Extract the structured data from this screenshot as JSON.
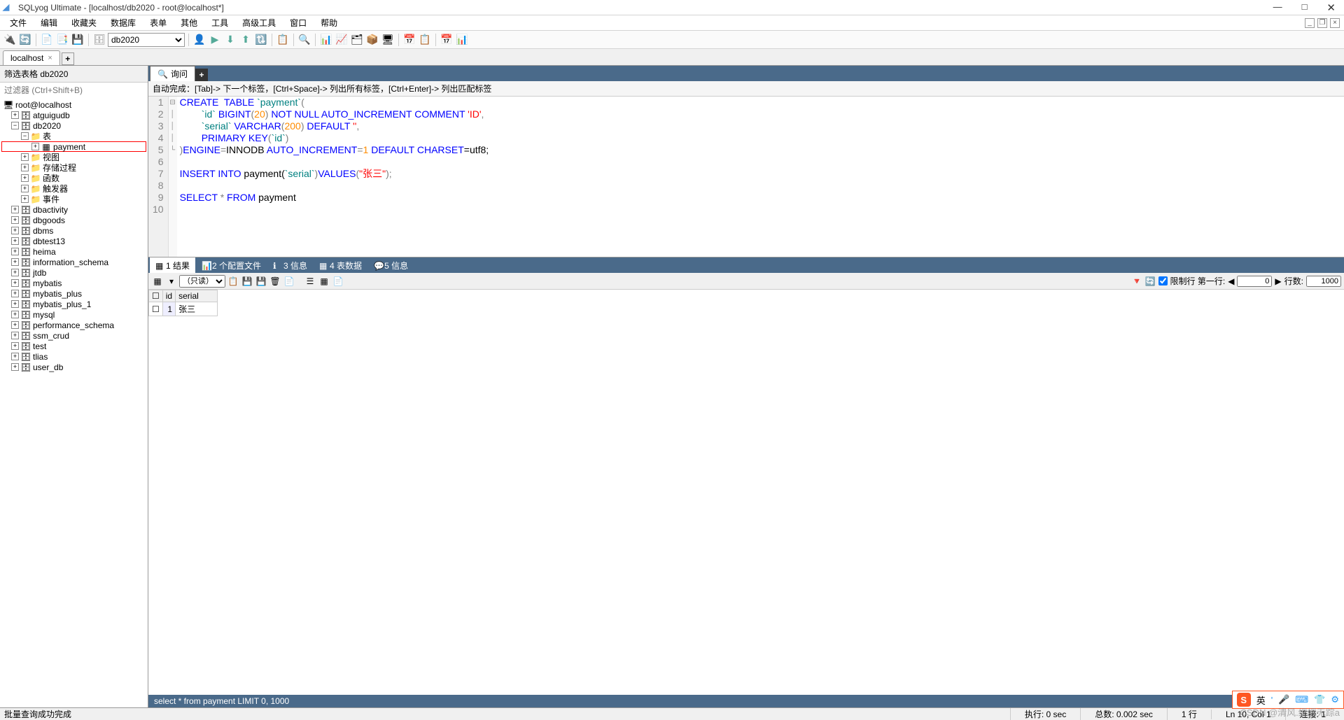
{
  "title": "SQLyog Ultimate - [localhost/db2020 - root@localhost*]",
  "menu": [
    "文件",
    "编辑",
    "收藏夹",
    "数据库",
    "表单",
    "其他",
    "工具",
    "高级工具",
    "窗口",
    "帮助"
  ],
  "db_dropdown": "db2020",
  "conn_tab": "localhost",
  "filter_label": "筛选表格 db2020",
  "filter_placeholder": "过滤器 (Ctrl+Shift+B)",
  "tree": {
    "root": "root@localhost",
    "databases": [
      "atguigudb",
      "db2020"
    ],
    "db2020_children": [
      {
        "label": "表",
        "exp": "−"
      },
      {
        "label": "payment",
        "highlighted": true,
        "indent": 3
      },
      {
        "label": "视图",
        "exp": "+"
      },
      {
        "label": "存储过程",
        "exp": "+"
      },
      {
        "label": "函数",
        "exp": "+"
      },
      {
        "label": "触发器",
        "exp": "+"
      },
      {
        "label": "事件",
        "exp": "+"
      }
    ],
    "rest": [
      "dbactivity",
      "dbgoods",
      "dbms",
      "dbtest13",
      "heima",
      "information_schema",
      "jtdb",
      "mybatis",
      "mybatis_plus",
      "mybatis_plus_1",
      "mysql",
      "performance_schema",
      "ssm_crud",
      "test",
      "tlias",
      "user_db"
    ]
  },
  "query_tab": "询问",
  "hint": "自动完成：[Tab]-> 下一个标签，[Ctrl+Space]-> 列出所有标签，[Ctrl+Enter]-> 列出匹配标签",
  "code_lines": [
    1,
    2,
    3,
    4,
    5,
    6,
    7,
    8,
    9,
    10
  ],
  "sql": {
    "l1": {
      "a": "CREATE",
      "b": "TABLE",
      "c": "`payment`",
      "d": "("
    },
    "l2": {
      "a": "`id`",
      "b": "BIGINT",
      "c": "(",
      "d": "20",
      "e": ")",
      "f": "NOT",
      "g": "NULL",
      "h": "AUTO_INCREMENT",
      "i": "COMMENT",
      "j": "'ID'",
      "k": ","
    },
    "l3": {
      "a": "`serial`",
      "b": "VARCHAR",
      "c": "(",
      "d": "200",
      "e": ")",
      "f": "DEFAULT",
      "g": "''",
      "h": ","
    },
    "l4": {
      "a": "PRIMARY",
      "b": "KEY",
      "c": "(",
      "d": "`id`",
      "e": ")"
    },
    "l5": {
      "a": ")",
      "b": "ENGINE",
      "c": "=",
      "d": "INNODB",
      "e": "AUTO_INCREMENT",
      "f": "=",
      "g": "1",
      "h": "DEFAULT",
      "i": "CHARSET",
      "j": "=utf8;"
    },
    "l7": {
      "a": "INSERT",
      "b": "INTO",
      "c": "payment(",
      "d": "`serial`",
      "e": ")",
      "f": "VALUES",
      "g": "(",
      "h": "\"张三\"",
      "i": ");"
    },
    "l9": {
      "a": "SELECT",
      "b": "*",
      "c": "FROM",
      "d": "payment"
    }
  },
  "result_tabs": [
    "1 结果",
    "2 个配置文件",
    "3 信息",
    "4 表数据",
    "5 信息"
  ],
  "readonly": "（只读）",
  "limit_label": "限制行 第一行:",
  "first_row": "0",
  "row_count_label": "行数:",
  "row_count": "1000",
  "grid": {
    "headers": [
      "id",
      "serial"
    ],
    "rows": [
      [
        "1",
        "张三"
      ]
    ]
  },
  "sql_status": "select * from payment LIMIT 0, 1000",
  "status": {
    "msg": "批量查询成功完成",
    "exec": "执行: 0 sec",
    "total": "总数: 0.002 sec",
    "rows": "1 行",
    "pos": "Ln 10, Col 1",
    "conn": "连接: 1"
  },
  "sogou": {
    "label": "英",
    "sep": "'"
  },
  "watermark": "CSDN @清风.缓缓无踪a"
}
